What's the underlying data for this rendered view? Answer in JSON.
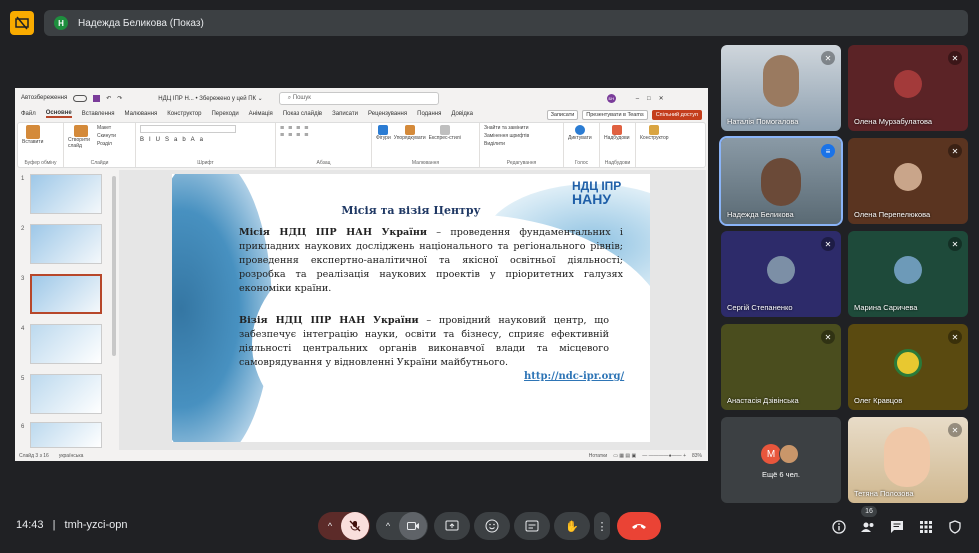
{
  "header": {
    "avatar_letter": "Н",
    "title": "Надежда Беликова (Показ)"
  },
  "ppt": {
    "autosave": "Автозбереження",
    "file": "НДЦ ІПР Н... • Збережено у цей ПК ⌄",
    "search_placeholder": "Пошук",
    "user_initials": "БН",
    "menu": [
      "Файл",
      "Основне",
      "Вставлення",
      "Малювання",
      "Конструктор",
      "Переходи",
      "Анімація",
      "Показ слайдів",
      "Записати",
      "Рецензування",
      "Подання",
      "Довідка"
    ],
    "record": "Записати",
    "present_teams": "Презентувати в Teams",
    "share": "Спільний доступ",
    "ribbon": {
      "clipboard": "Буфер обміну",
      "paste": "Вставити",
      "new_slide": "Створити слайд",
      "slides": "Слайди",
      "layout": "Макет",
      "reset": "Скинути",
      "section": "Розділ",
      "font": "Шрифт",
      "paragraph": "Абзац",
      "drawing": "Малювання",
      "shapes": "Фігури",
      "arrange": "Упорядкувати",
      "express": "Експрес-стилі",
      "find": "Знайти та замінити",
      "replace_fonts": "Замінення шрифтів",
      "select": "Виділити",
      "editing": "Редагування",
      "dictate": "Диктувати",
      "voice": "Голос",
      "addins": "Надбудови",
      "addins_group": "Надбудови",
      "designer": "Конструктор"
    },
    "thumb_numbers": [
      "1",
      "2",
      "3",
      "4",
      "5",
      "6"
    ],
    "slide": {
      "title": "Місія та візія Центру",
      "p1_bold": "Місія НДЦ ІПР НАН України",
      "p1_text": " – проведення фундаментальних і прикладних наукових досліджень національного та регіонального рівнів; проведення експертно-аналітичної та якісної освітньої діяльності; розробка та реалізація наукових проектів у пріоритетних галузях економіки країни.",
      "p2_bold": "Візія НДЦ ІПР НАН України",
      "p2_text": " – провідний науковий центр, що забезпечує інтеграцію науки, освіти та бізнесу, сприяє ефективній діяльності центральних органів виконавчої влади та місцевого самоврядування у відновленні України майбутнього.",
      "link": "http://ndc-ipr.org/",
      "logo_line1": "НДЦ ІПР",
      "logo_line2": "НАНУ"
    },
    "status": {
      "slide": "Слайд 3 з 16",
      "lang": "українська",
      "notes": "Нотатки",
      "zoom": "83%"
    }
  },
  "participants": [
    {
      "name": "Наталія Помогалова",
      "muted": true
    },
    {
      "name": "Олена Мурзабулатова",
      "muted": true
    },
    {
      "name": "Надежда Беликова",
      "muted": false
    },
    {
      "name": "Олена Перепелюкова",
      "muted": true
    },
    {
      "name": "Сергій Степаненко",
      "muted": true
    },
    {
      "name": "Марина Саричева",
      "muted": true
    },
    {
      "name": "Анастасія Дзівінська",
      "muted": true
    },
    {
      "name": "Олег Кравцов",
      "muted": true
    },
    {
      "name": "Ещё 6 чел.",
      "avatar_letter": "М"
    },
    {
      "name": "Тетяна Полозова",
      "muted": true
    }
  ],
  "bottom": {
    "time": "14:43",
    "separator": "|",
    "meeting_code": "tmh-yzci-opn",
    "people_count": "16"
  },
  "colors": {
    "bg": "#202124",
    "end_call": "#ea4335",
    "muted": "#f9dedc",
    "accent": "#8ab4f8"
  }
}
